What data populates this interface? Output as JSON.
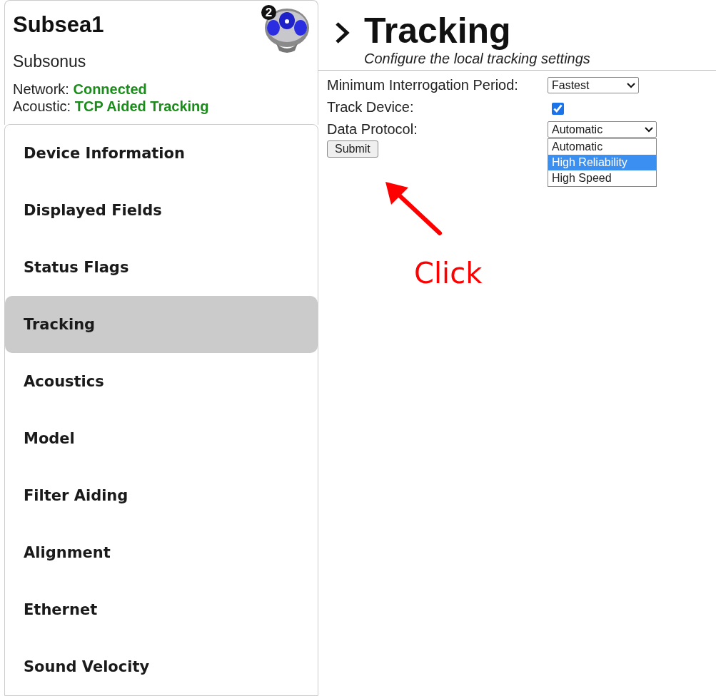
{
  "device": {
    "name": "Subsea1",
    "badge": "2",
    "model": "Subsonus",
    "status": [
      {
        "label": "Network:",
        "value": "Connected"
      },
      {
        "label": "Acoustic:",
        "value": "TCP Aided Tracking"
      }
    ]
  },
  "sidebar": {
    "items": [
      {
        "label": "Device Information",
        "selected": false
      },
      {
        "label": "Displayed Fields",
        "selected": false
      },
      {
        "label": "Status Flags",
        "selected": false
      },
      {
        "label": "Tracking",
        "selected": true
      },
      {
        "label": "Acoustics",
        "selected": false
      },
      {
        "label": "Model",
        "selected": false
      },
      {
        "label": "Filter Aiding",
        "selected": false
      },
      {
        "label": "Alignment",
        "selected": false
      },
      {
        "label": "Ethernet",
        "selected": false
      },
      {
        "label": "Sound Velocity",
        "selected": false
      }
    ]
  },
  "page": {
    "title": "Tracking",
    "subtitle": "Configure the local tracking settings"
  },
  "form": {
    "fields": [
      {
        "kind": "select",
        "label": "Minimum Interrogation Period:",
        "value": "Fastest"
      },
      {
        "kind": "checkbox",
        "label": "Track Device:",
        "checked": true
      },
      {
        "kind": "select",
        "label": "Data Protocol:",
        "value": "Automatic",
        "expanded": true,
        "options": [
          {
            "label": "Automatic",
            "highlighted": false
          },
          {
            "label": "High Reliability",
            "highlighted": true
          },
          {
            "label": "High Speed",
            "highlighted": false
          }
        ]
      }
    ],
    "submit": "Submit"
  },
  "annotation": {
    "text": "Click"
  }
}
